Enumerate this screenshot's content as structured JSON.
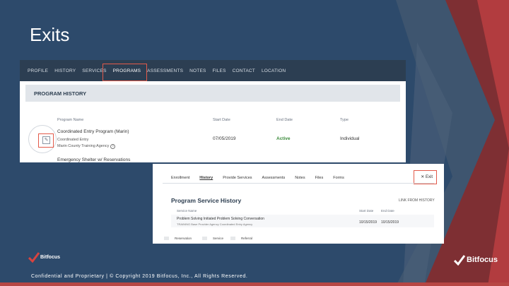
{
  "slide": {
    "title": "Exits",
    "footer": "Confidential and Proprietary | © Copyright 2019 Bitfocus, Inc., All Rights Reserved."
  },
  "logo": {
    "left_text": "Bitfocus",
    "right_text": "Bitfocus"
  },
  "screenshot1": {
    "tabs": [
      "PROFILE",
      "HISTORY",
      "SERVICES",
      "PROGRAMS",
      "ASSESSMENTS",
      "NOTES",
      "FILES",
      "CONTACT",
      "LOCATION"
    ],
    "section_title": "PROGRAM HISTORY",
    "columns": {
      "program_name": "Program Name",
      "start_date": "Start Date",
      "end_date": "End Date",
      "type": "Type"
    },
    "row1": {
      "program": "Coordinated Entry Program (Marin)",
      "subtitle": "Coordinated Entry",
      "agency": "Marin County Training Agency",
      "start_date": "07/05/2019",
      "end_date": "Active",
      "type": "Individual"
    },
    "row2": {
      "program": "Emergency Shelter w/ Reservations"
    }
  },
  "screenshot2": {
    "tabs": [
      "Enrollment",
      "History",
      "Provide Services",
      "Assessments",
      "Notes",
      "Files",
      "Forms"
    ],
    "exit_label": "✕ Exit",
    "title": "Program Service History",
    "link": "LINK FROM HISTORY",
    "columns": {
      "service_name": "Service Name",
      "start_date": "Start Date",
      "end_date": "End Date"
    },
    "row": {
      "service": "Problem Solving Initiated Problem Solving Conversation",
      "sub": "TRAINING Base Provider Agency  Coordinated Entry Agency",
      "start": "10/15/2019",
      "end": "10/15/2019"
    },
    "legend": [
      "Reservation",
      "Service",
      "Referral"
    ]
  },
  "colors": {
    "background": "#2d4a6b",
    "highlight": "#e35a4a",
    "tabbar": "#2c3e52"
  }
}
